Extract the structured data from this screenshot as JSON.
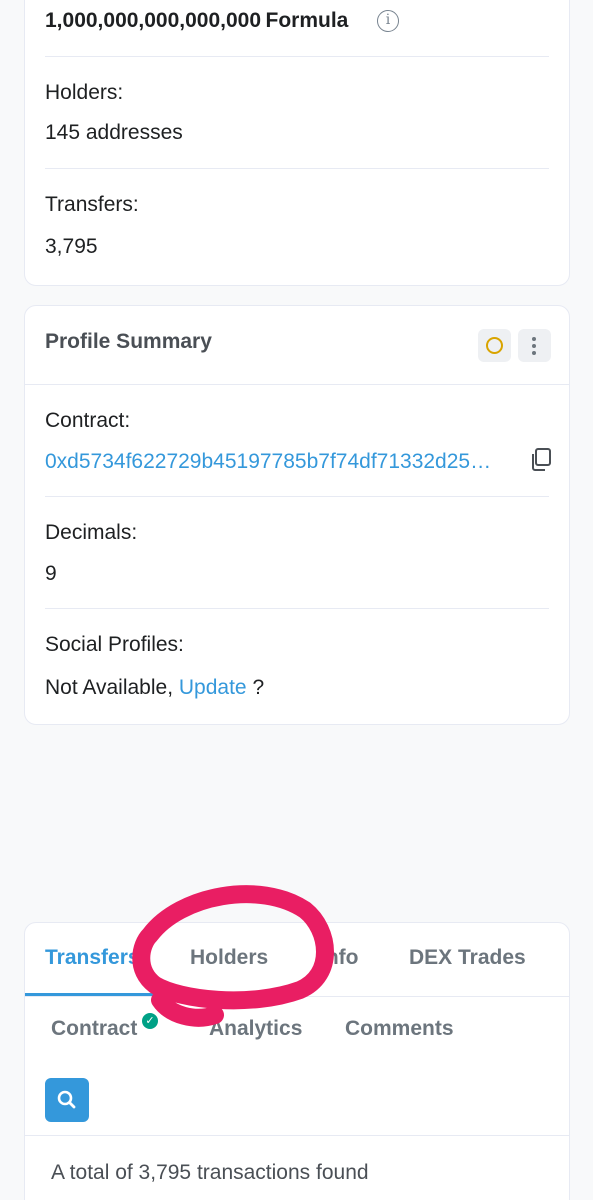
{
  "overview": {
    "max_supply_value": "1,000,000,000,000,000",
    "max_supply_unit": "Formula",
    "info_icon": "info-icon",
    "holders_label": "Holders:",
    "holders_value": "145 addresses",
    "transfers_label": "Transfers:",
    "transfers_value": "3,795"
  },
  "profile": {
    "title": "Profile Summary",
    "status_icon": "circle-icon",
    "menu_icon": "kebab-icon",
    "contract_label": "Contract:",
    "contract_address": "0xd5734f622729b45197785b7f74df71332d25…",
    "copy_icon": "copy-icon",
    "decimals_label": "Decimals:",
    "decimals_value": "9",
    "social_label": "Social Profiles:",
    "social_value": "Not Available,",
    "social_update_link": "Update",
    "social_suffix": "?"
  },
  "tabs": {
    "items": [
      {
        "label": "Transfers",
        "active": true
      },
      {
        "label": "Holders",
        "active": false
      },
      {
        "label": "Info",
        "active": false
      },
      {
        "label": "DEX Trades",
        "active": false
      },
      {
        "label": "Contract",
        "active": false
      },
      {
        "label": "Analytics",
        "active": false
      },
      {
        "label": "Comments",
        "active": false
      }
    ],
    "search_icon": "search-icon",
    "total_text": "A total of 3,795 transactions found"
  },
  "colors": {
    "accent": "#3498db",
    "verified": "#00a186",
    "annotation": "#e91e63"
  }
}
